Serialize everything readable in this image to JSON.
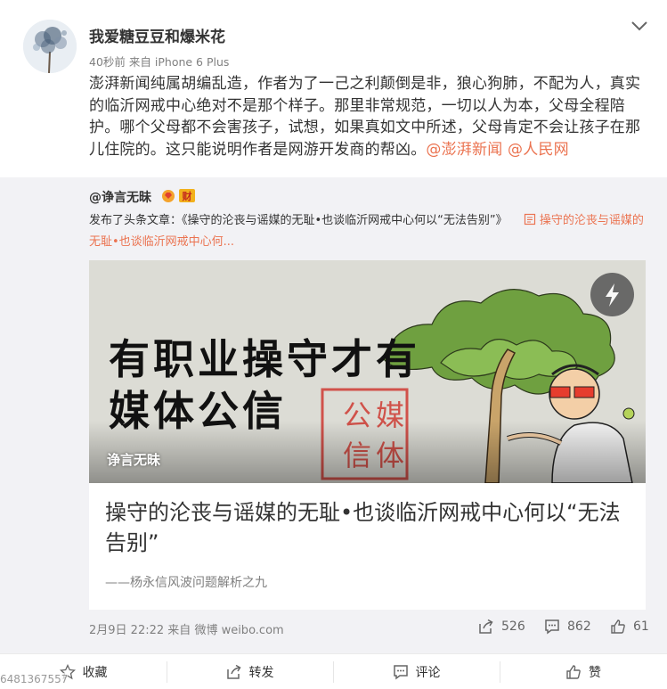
{
  "post": {
    "username": "我爱糖豆豆和爆米花",
    "time": "40秒前",
    "source_prefix": "来自",
    "source": "iPhone 6 Plus",
    "text_main": "澎湃新闻纯属胡编乱造，作者为了一己之利颠倒是非，狼心狗肺，不配为人，真实的临沂网戒中心绝对不是那个样子。那里非常规范，一切以人为本，父母全程陪护。哪个父母都不会害孩子，试想，如果真如文中所述，父母肯定不会让孩子在那儿住院的。这只能说明作者是网游开发商的帮凶。",
    "mention_1": "@澎湃新闻",
    "mention_2": "@人民网"
  },
  "repost": {
    "username": "@诤言无昧",
    "badge_label": "财",
    "text_prefix": "发布了头条文章：《操守的沦丧与谣媒的无耻•也谈临沂网戒中心何以“无法告别”》",
    "link_text": "操守的沦丧与谣媒的无耻•也谈临沂网戒中心何...",
    "article": {
      "image_line_1": "有职业操守才有",
      "image_line_2": "媒体公信",
      "image_stamp_chars": [
        "公",
        "媒",
        "信",
        "体"
      ],
      "image_source": "诤言无昧",
      "title": "操守的沦丧与谣媒的无耻•也谈临沂网戒中心何以“无法告别”",
      "subtitle": "——杨永信风波问题解析之九"
    },
    "date": "2月9日 22:22",
    "via_prefix": "来自",
    "via": "微博 weibo.com",
    "reposts": "526",
    "comments": "862",
    "likes": "61"
  },
  "actions": {
    "favorite": "收藏",
    "forward": "转发",
    "comment": "评论",
    "like": "赞"
  },
  "watermark": "6481367557",
  "colors": {
    "accent": "#eb7350",
    "text": "#333333",
    "muted": "#808080",
    "repost_bg": "#f2f2f5"
  }
}
